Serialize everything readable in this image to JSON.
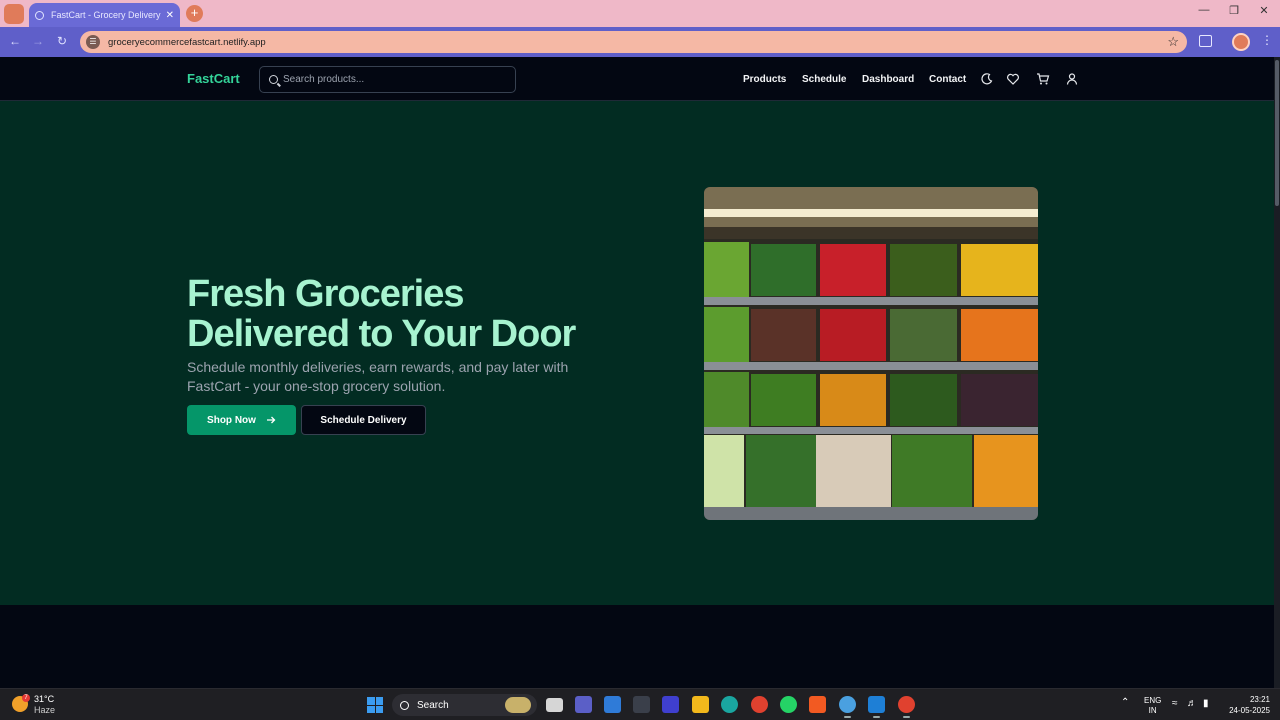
{
  "browser": {
    "tab_title": "FastCart - Grocery Delivery Platf",
    "new_tab": "+",
    "tab_close": "✕",
    "url": "groceryecommercefastcart.netlify.app"
  },
  "site": {
    "logo": "FastCart",
    "search_placeholder": "Search products...",
    "nav": [
      "Products",
      "Schedule",
      "Dashboard",
      "Contact"
    ],
    "icons": [
      "moon-icon",
      "heart-icon",
      "cart-icon",
      "user-icon"
    ]
  },
  "hero": {
    "headline": "Fresh Groceries Delivered to Your Door",
    "subline": "Schedule monthly deliveries, earn rewards, and pay later with FastCart - your one-stop grocery solution.",
    "primary_button": "Shop Now",
    "secondary_button": "Schedule Delivery",
    "image": "grocery-shelves-produce"
  },
  "colors": {
    "accent": "#34d399",
    "hero_bg": "#022c22",
    "headline": "#a7f3d0",
    "primary_btn": "#059669"
  },
  "taskbar": {
    "weather_badge": "7",
    "temperature": "31°C",
    "condition": "Haze",
    "search_label": "Search",
    "lang_top": "ENG",
    "lang_bottom": "IN",
    "time": "23:21",
    "date": "24-05-2025"
  }
}
